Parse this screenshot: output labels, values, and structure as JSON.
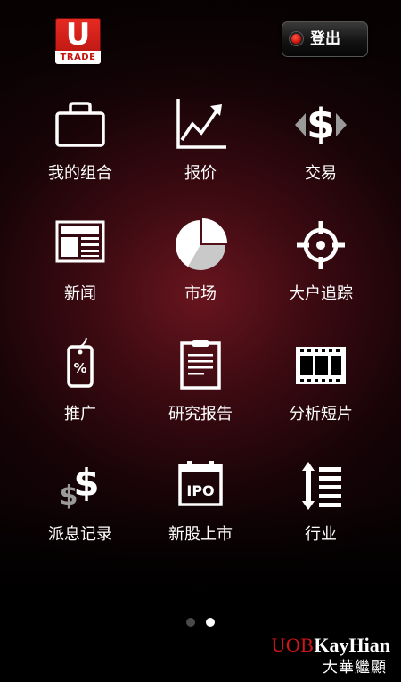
{
  "header": {
    "logo_letter": "U",
    "logo_text": "TRADE",
    "logout_label": "登出",
    "logout_indicator_color": "#e0140c"
  },
  "menu": {
    "items": [
      {
        "label": "我的组合",
        "icon": "briefcase-icon"
      },
      {
        "label": "报价",
        "icon": "line-chart-icon"
      },
      {
        "label": "交易",
        "icon": "dollar-exchange-icon"
      },
      {
        "label": "新闻",
        "icon": "newspaper-icon"
      },
      {
        "label": "市场",
        "icon": "pie-chart-icon"
      },
      {
        "label": "大户追踪",
        "icon": "crosshair-icon"
      },
      {
        "label": "推广",
        "icon": "percent-tag-icon"
      },
      {
        "label": "研究报告",
        "icon": "clipboard-report-icon"
      },
      {
        "label": "分析短片",
        "icon": "film-strip-icon"
      },
      {
        "label": "派息记录",
        "icon": "dividend-dollar-icon"
      },
      {
        "label": "新股上市",
        "icon": "ipo-icon"
      },
      {
        "label": "行业",
        "icon": "sector-list-icon"
      }
    ]
  },
  "pager": {
    "current_page": 2,
    "total_pages": 2
  },
  "brand": {
    "name_part1": "UOB",
    "name_part2": "KayHian",
    "name_cn": "大華繼顯",
    "accent_color": "#d3141b"
  },
  "colors": {
    "background_center": "#6e1620",
    "background_edge": "#000000",
    "icon_color": "#ffffff"
  }
}
